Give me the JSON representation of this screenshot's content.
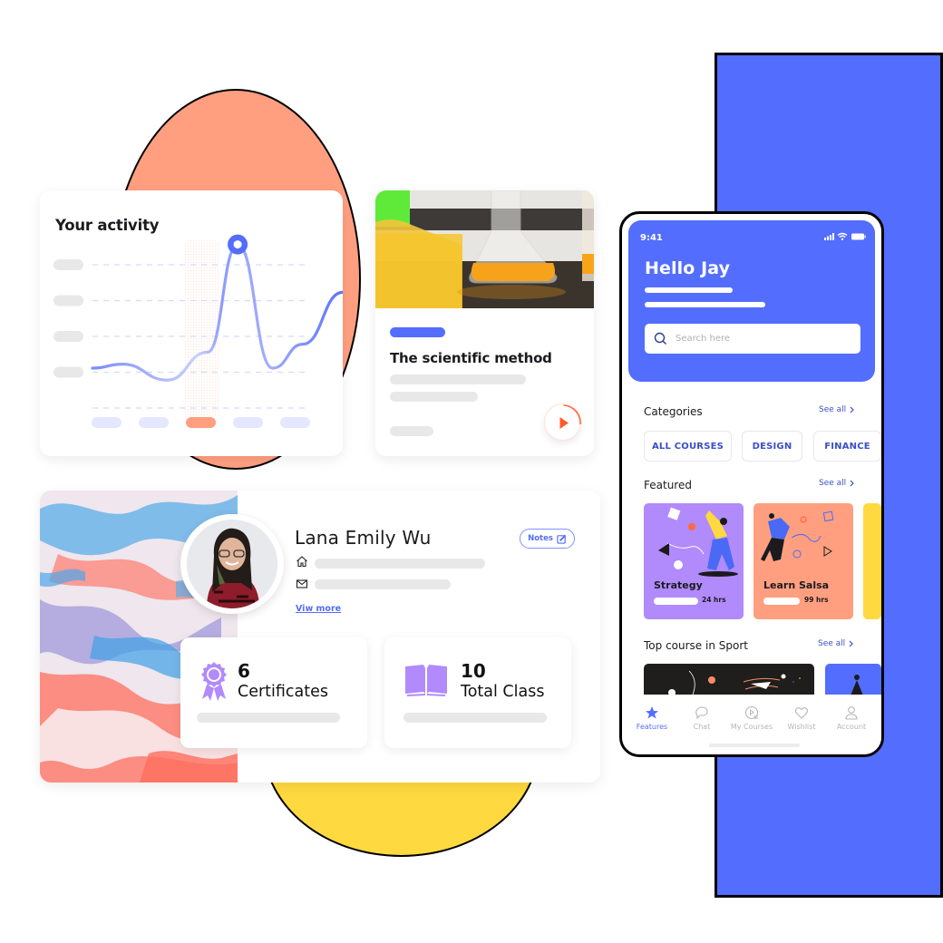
{
  "colors": {
    "brand_blue": "#536dfe",
    "salmon": "#ff9f80",
    "yellow": "#ffd93f",
    "purple": "#b18afb",
    "text_dark": "#1b1b1f",
    "muted_bar": "#e8e8e8"
  },
  "activity_card": {
    "title": "Your activity",
    "chart_data": {
      "type": "line",
      "title": "Your activity",
      "categories": [
        "",
        "",
        "",
        "",
        ""
      ],
      "highlighted_category_index": 2,
      "y_levels": 5,
      "series": [
        {
          "name": "activity",
          "x": [
            0,
            0.6,
            1.5,
            2.3,
            2.9,
            3.6,
            4.2,
            5.0
          ],
          "values": [
            1.0,
            1.1,
            0.7,
            1.4,
            4.1,
            1.0,
            1.6,
            2.9
          ]
        }
      ],
      "highlight_point_index": 4,
      "ylim": [
        0,
        4.5
      ],
      "grid": true
    }
  },
  "course_card": {
    "title": "The scientific method",
    "play_icon": "play-icon"
  },
  "profile_card": {
    "name": "Lana Emily Wu",
    "notes_button": "Notes",
    "view_more": "Viw more",
    "home_icon": "home-icon",
    "mail_icon": "mail-icon",
    "stats": [
      {
        "value": "6",
        "label": "Certificates",
        "icon": "award-ribbon-icon"
      },
      {
        "value": "10",
        "label": "Total Class",
        "icon": "open-book-icon"
      }
    ]
  },
  "phone": {
    "status_time": "9:41",
    "greeting": "Hello Jay",
    "search_placeholder": "Search here",
    "categories_title": "Categories",
    "featured_title": "Featured",
    "sport_title": "Top course in Sport",
    "see_all": "See all",
    "categories": [
      "ALL COURSES",
      "DESIGN",
      "FINANCE"
    ],
    "featured": [
      {
        "title": "Strategy",
        "hours": "24 hrs",
        "color": "#b18afb"
      },
      {
        "title": "Learn Salsa",
        "hours": "99 hrs",
        "color": "#ff9f80"
      }
    ],
    "tabs": [
      {
        "label": "Features",
        "icon": "star-icon",
        "active": true
      },
      {
        "label": "Chat",
        "icon": "chat-icon",
        "active": false
      },
      {
        "label": "My Courses",
        "icon": "play-list-icon",
        "active": false
      },
      {
        "label": "Wishlist",
        "icon": "heart-icon",
        "active": false
      },
      {
        "label": "Account",
        "icon": "user-icon",
        "active": false
      }
    ]
  }
}
